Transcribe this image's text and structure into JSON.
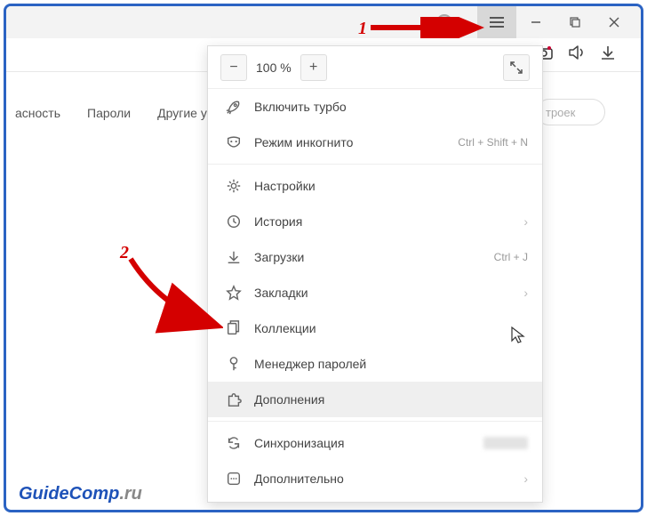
{
  "window": {
    "avatar": true,
    "buttons": {
      "menu": "≡",
      "min": "—",
      "max": "▢",
      "close": "✕"
    }
  },
  "toolbar": {
    "camera": "camera-icon",
    "sound": "sound-icon",
    "download": "download-icon"
  },
  "page": {
    "tabs": [
      "асность",
      "Пароли",
      "Другие у"
    ],
    "search_partial": "троек"
  },
  "menu": {
    "zoom": {
      "minus": "−",
      "value": "100 %",
      "plus": "+",
      "fullscreen": "⤢"
    },
    "items": [
      {
        "icon": "rocket-icon",
        "label": "Включить турбо"
      },
      {
        "icon": "mask-icon",
        "label": "Режим инкогнито",
        "shortcut": "Ctrl + Shift + N"
      },
      {
        "sep": true
      },
      {
        "icon": "gear-icon",
        "label": "Настройки"
      },
      {
        "icon": "clock-icon",
        "label": "История",
        "submenu": true
      },
      {
        "icon": "download-icon",
        "label": "Загрузки",
        "shortcut": "Ctrl + J"
      },
      {
        "icon": "star-icon",
        "label": "Закладки",
        "submenu": true
      },
      {
        "icon": "collection-icon",
        "label": "Коллекции"
      },
      {
        "icon": "key-icon",
        "label": "Менеджер паролей"
      },
      {
        "icon": "puzzle-icon",
        "label": "Дополнения",
        "hover": true
      },
      {
        "sep": true
      },
      {
        "icon": "sync-icon",
        "label": "Синхронизация",
        "blurred_right": true
      },
      {
        "icon": "more-icon",
        "label": "Дополнительно",
        "submenu": true
      }
    ]
  },
  "annotations": {
    "num1": "1",
    "num2": "2"
  },
  "watermark": {
    "part1": "GuideComp",
    "part2": ".ru"
  }
}
